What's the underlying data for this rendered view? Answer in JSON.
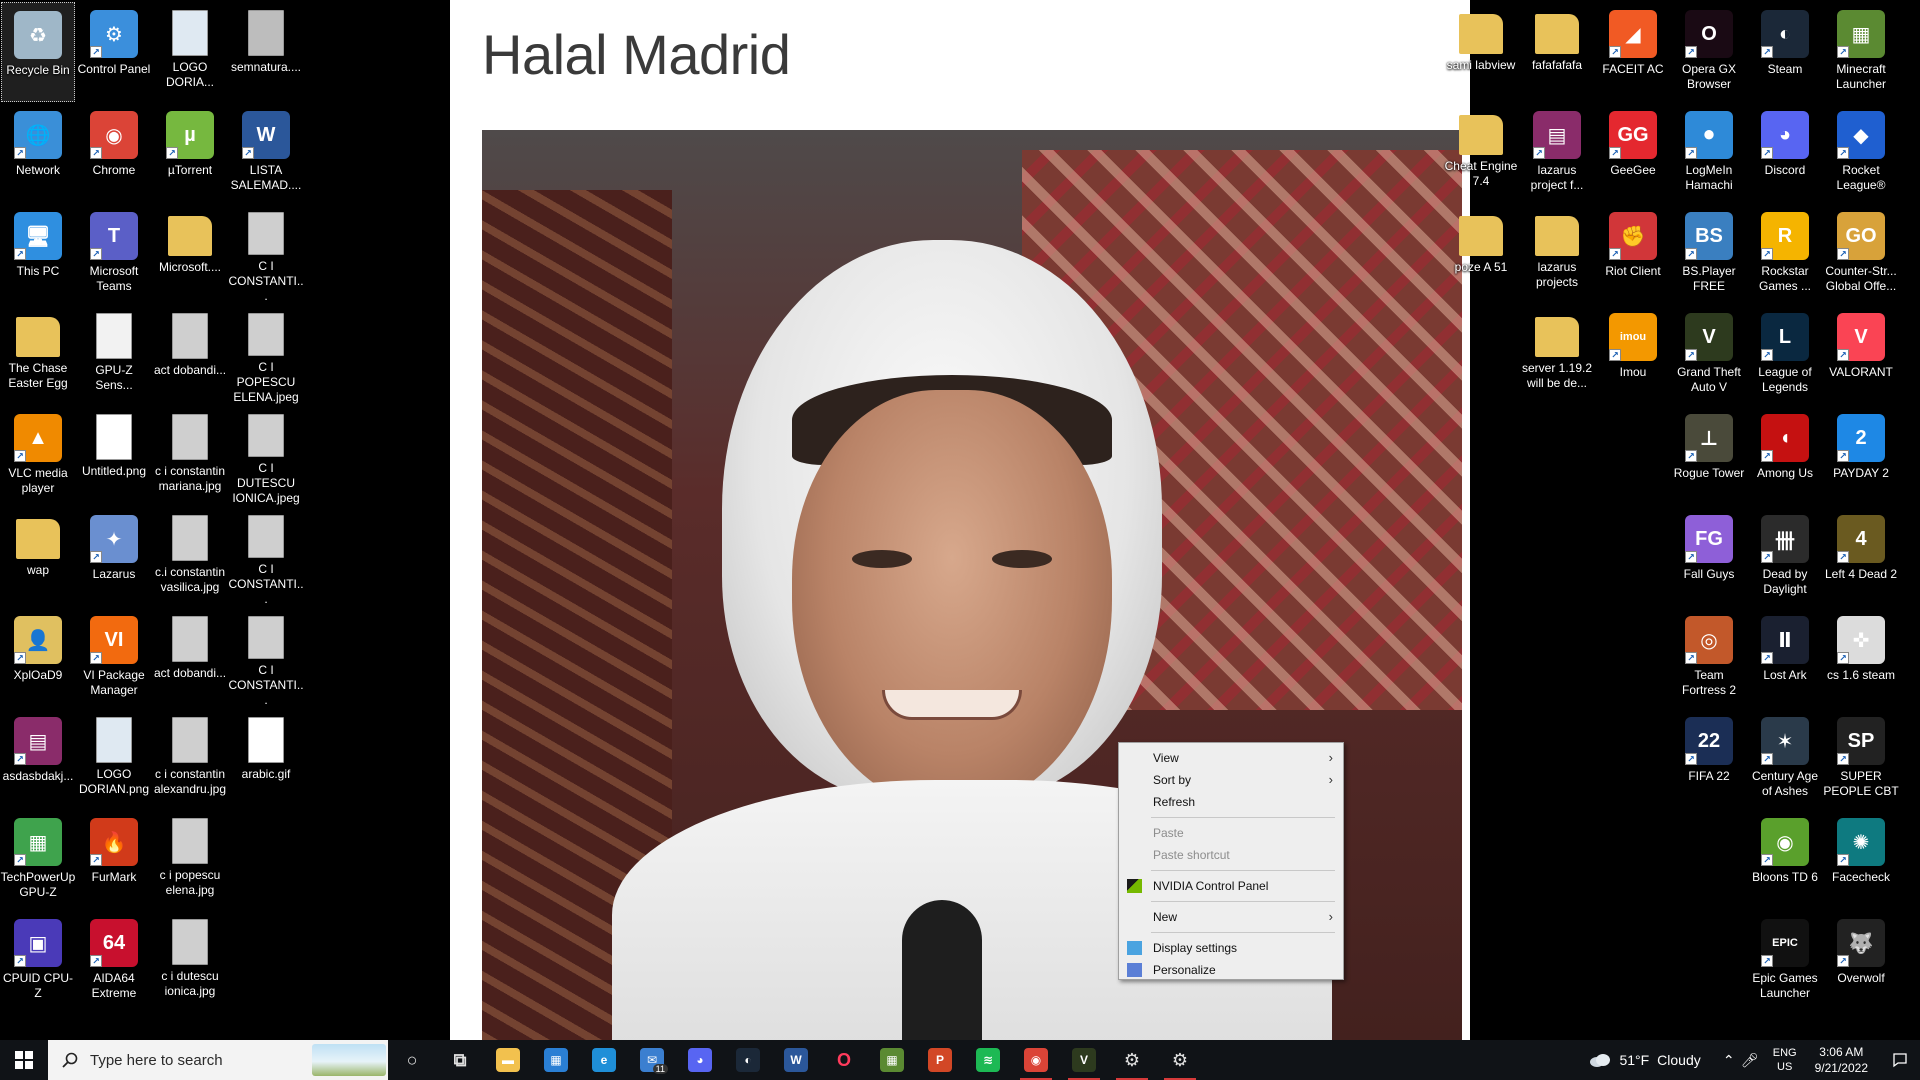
{
  "wallpaper": {
    "title": "Halal Madrid"
  },
  "left_icons": [
    [
      {
        "label": "Recycle Bin",
        "icon": "recycle-bin-icon",
        "color": "#9fb7c8",
        "glyph": "♻",
        "selected": true
      },
      {
        "label": "Network",
        "icon": "network-icon",
        "color": "#3a8fd8",
        "glyph": "🌐"
      },
      {
        "label": "This PC",
        "icon": "computer-icon",
        "color": "#2f8fe0",
        "glyph": "🖥"
      },
      {
        "label": "The Chase Easter Egg",
        "icon": "folder-icon",
        "color": "#e8c25a",
        "glyph": ""
      },
      {
        "label": "VLC media player",
        "icon": "vlc-icon",
        "color": "#f08a00",
        "glyph": "▲"
      },
      {
        "label": "wap",
        "icon": "folder-icon",
        "color": "#e8c25a",
        "glyph": ""
      },
      {
        "label": "XplOaD9",
        "icon": "user-folder-icon",
        "color": "#e0c060",
        "glyph": "👤"
      },
      {
        "label": "asdasbdakj...",
        "icon": "winrar-icon",
        "color": "#8a2c6a",
        "glyph": "▤"
      },
      {
        "label": "TechPowerUp GPU-Z",
        "icon": "gpuz-icon",
        "color": "#3fa34d",
        "glyph": "▦"
      },
      {
        "label": "CPUID CPU-Z",
        "icon": "cpuz-icon",
        "color": "#4a3ab8",
        "glyph": "▣"
      }
    ],
    [
      {
        "label": "Control Panel",
        "icon": "control-panel-icon",
        "color": "#3b8fdc",
        "glyph": "⚙"
      },
      {
        "label": "Chrome",
        "icon": "chrome-icon",
        "color": "#db4437",
        "glyph": "◉"
      },
      {
        "label": "Microsoft Teams",
        "icon": "teams-icon",
        "color": "#5b5fc7",
        "glyph": "T"
      },
      {
        "label": "GPU-Z Sens...",
        "icon": "text-file-icon",
        "color": "#f2f2f2",
        "glyph": ""
      },
      {
        "label": "Untitled.png",
        "icon": "image-file-icon",
        "color": "#ffffff",
        "glyph": ""
      },
      {
        "label": "Lazarus",
        "icon": "lazarus-icon",
        "color": "#6a8fd0",
        "glyph": "✦"
      },
      {
        "label": "VI Package Manager",
        "icon": "vipm-icon",
        "color": "#f26a0f",
        "glyph": "VI"
      },
      {
        "label": "LOGO DORIAN.png",
        "icon": "image-file-icon",
        "color": "#dfe9f2",
        "glyph": ""
      },
      {
        "label": "FurMark",
        "icon": "furmark-icon",
        "color": "#d13a1a",
        "glyph": "🔥"
      },
      {
        "label": "AIDA64 Extreme",
        "icon": "aida64-icon",
        "color": "#c8102e",
        "glyph": "64"
      }
    ],
    [
      {
        "label": "LOGO DORIA...",
        "icon": "image-file-icon",
        "color": "#dfe9f2",
        "glyph": ""
      },
      {
        "label": "µTorrent",
        "icon": "utorrent-icon",
        "color": "#76b83f",
        "glyph": "µ"
      },
      {
        "label": "Microsoft....",
        "icon": "folder-icon",
        "color": "#e8c25a",
        "glyph": ""
      },
      {
        "label": "act dobandi...",
        "icon": "image-file-icon",
        "color": "#cfcfcf",
        "glyph": ""
      },
      {
        "label": "c i constantin mariana.jpg",
        "icon": "image-file-icon",
        "color": "#cfcfcf",
        "glyph": ""
      },
      {
        "label": "c.i constantin vasilica.jpg",
        "icon": "image-file-icon",
        "color": "#cfcfcf",
        "glyph": ""
      },
      {
        "label": "act dobandi...",
        "icon": "image-file-icon",
        "color": "#cfcfcf",
        "glyph": ""
      },
      {
        "label": "c i constantin alexandru.jpg",
        "icon": "image-file-icon",
        "color": "#cfcfcf",
        "glyph": ""
      },
      {
        "label": "c i popescu elena.jpg",
        "icon": "image-file-icon",
        "color": "#cfcfcf",
        "glyph": ""
      },
      {
        "label": "c i dutescu ionica.jpg",
        "icon": "image-file-icon",
        "color": "#cfcfcf",
        "glyph": ""
      }
    ],
    [
      {
        "label": "semnatura....",
        "icon": "image-file-icon",
        "color": "#bdbdbd",
        "glyph": ""
      },
      {
        "label": "LISTA SALEMAD....",
        "icon": "word-doc-icon",
        "color": "#2b579a",
        "glyph": "W"
      },
      {
        "label": "C I CONSTANTI...",
        "icon": "image-file-icon",
        "color": "#cfcfcf",
        "glyph": ""
      },
      {
        "label": "C I POPESCU ELENA.jpeg",
        "icon": "image-file-icon",
        "color": "#cfcfcf",
        "glyph": ""
      },
      {
        "label": "C I DUTESCU IONICA.jpeg",
        "icon": "image-file-icon",
        "color": "#cfcfcf",
        "glyph": ""
      },
      {
        "label": "C I CONSTANTI...",
        "icon": "image-file-icon",
        "color": "#cfcfcf",
        "glyph": ""
      },
      {
        "label": "C I CONSTANTI...",
        "icon": "image-file-icon",
        "color": "#cfcfcf",
        "glyph": ""
      },
      {
        "label": "arabic.gif",
        "icon": "image-file-icon",
        "color": "#ffffff",
        "glyph": ""
      }
    ]
  ],
  "right_icons": [
    [
      {
        "label": "sami labview",
        "icon": "folder-icon",
        "color": "#e8c25a",
        "glyph": ""
      },
      {
        "label": "Cheat Engine 7.4",
        "icon": "folder-icon",
        "color": "#e8c25a",
        "glyph": ""
      },
      {
        "label": "poze A 51",
        "icon": "folder-icon",
        "color": "#e8c25a",
        "glyph": ""
      }
    ],
    [
      {
        "label": "fafafafafa",
        "icon": "folder-icon",
        "color": "#e8c25a",
        "glyph": ""
      },
      {
        "label": "lazarus project f...",
        "icon": "winrar-icon",
        "color": "#8a2c6a",
        "glyph": "▤"
      },
      {
        "label": "lazarus projects",
        "icon": "folder-icon",
        "color": "#e8c25a",
        "glyph": ""
      },
      {
        "label": "server 1.19.2 will be de...",
        "icon": "folder-icon",
        "color": "#e8c25a",
        "glyph": ""
      }
    ],
    [
      {
        "label": "FACEIT AC",
        "icon": "faceit-icon",
        "color": "#f15a24",
        "glyph": "◢"
      },
      {
        "label": "GeeGee",
        "icon": "geegee-icon",
        "color": "#e4282f",
        "glyph": "GG"
      },
      {
        "label": "Riot Client",
        "icon": "riot-icon",
        "color": "#d13639",
        "glyph": "✊"
      },
      {
        "label": "Imou",
        "icon": "imou-icon",
        "color": "#f39800",
        "glyph": "imou"
      }
    ],
    [
      {
        "label": "Opera GX Browser",
        "icon": "opera-gx-icon",
        "color": "#1a0a14",
        "glyph": "O"
      },
      {
        "label": "LogMeIn Hamachi",
        "icon": "hamachi-icon",
        "color": "#2e8ad8",
        "glyph": "⚫"
      },
      {
        "label": "BS.Player FREE",
        "icon": "bsplayer-icon",
        "color": "#3a7fc0",
        "glyph": "BS"
      },
      {
        "label": "Grand Theft Auto V",
        "icon": "gta-icon",
        "color": "#2d3a1e",
        "glyph": "V"
      },
      {
        "label": "Rogue Tower",
        "icon": "rogue-tower-icon",
        "color": "#4a4a3a",
        "glyph": "⊥"
      },
      {
        "label": "Fall Guys",
        "icon": "fall-guys-icon",
        "color": "#8e5fd8",
        "glyph": "FG"
      },
      {
        "label": "Team Fortress 2",
        "icon": "tf2-icon",
        "color": "#c2582a",
        "glyph": "◎"
      },
      {
        "label": "FIFA 22",
        "icon": "fifa-icon",
        "color": "#1b2e55",
        "glyph": "22"
      }
    ],
    [
      {
        "label": "Steam",
        "icon": "steam-icon",
        "color": "#1b2838",
        "glyph": "◐"
      },
      {
        "label": "Discord",
        "icon": "discord-icon",
        "color": "#5865f2",
        "glyph": "◕"
      },
      {
        "label": "Rockstar Games ...",
        "icon": "rockstar-icon",
        "color": "#f5b400",
        "glyph": "R"
      },
      {
        "label": "League of Legends",
        "icon": "lol-icon",
        "color": "#0a2840",
        "glyph": "L"
      },
      {
        "label": "Among Us",
        "icon": "among-us-icon",
        "color": "#c51111",
        "glyph": "◖"
      },
      {
        "label": "Dead by Daylight",
        "icon": "dbd-icon",
        "color": "#2b2b2b",
        "glyph": "卌"
      },
      {
        "label": "Lost Ark",
        "icon": "lost-ark-icon",
        "color": "#1a2030",
        "glyph": "Ⅱ"
      },
      {
        "label": "Century Age of Ashes",
        "icon": "century-icon",
        "color": "#2a3a4a",
        "glyph": "✶"
      },
      {
        "label": "Bloons TD 6",
        "icon": "bloons-icon",
        "color": "#5aa02c",
        "glyph": "◉"
      },
      {
        "label": "Epic Games Launcher",
        "icon": "epic-icon",
        "color": "#111111",
        "glyph": "EPIC"
      }
    ],
    [
      {
        "label": "Minecraft Launcher",
        "icon": "minecraft-icon",
        "color": "#5b8a32",
        "glyph": "▦"
      },
      {
        "label": "Rocket League®",
        "icon": "rocket-league-icon",
        "color": "#1f5fd0",
        "glyph": "◆"
      },
      {
        "label": "Counter-Str... Global Offe...",
        "icon": "csgo-icon",
        "color": "#d8a23a",
        "glyph": "GO"
      },
      {
        "label": "VALORANT",
        "icon": "valorant-icon",
        "color": "#fa4454",
        "glyph": "V"
      },
      {
        "label": "PAYDAY 2",
        "icon": "payday-icon",
        "color": "#1e88e5",
        "glyph": "2"
      },
      {
        "label": "Left 4 Dead 2",
        "icon": "l4d2-icon",
        "color": "#6a5a20",
        "glyph": "4"
      },
      {
        "label": "cs 1.6 steam",
        "icon": "cs16-icon",
        "color": "#dcdcdc",
        "glyph": "✜"
      },
      {
        "label": "SUPER PEOPLE CBT",
        "icon": "super-people-icon",
        "color": "#222222",
        "glyph": "SP"
      },
      {
        "label": "Facecheck",
        "icon": "facecheck-icon",
        "color": "#0e7a80",
        "glyph": "✺"
      },
      {
        "label": "Overwolf",
        "icon": "overwolf-icon",
        "color": "#222222",
        "glyph": "🐺"
      }
    ]
  ],
  "context_menu": {
    "items": [
      {
        "label": "View",
        "submenu": true,
        "disabled": false
      },
      {
        "label": "Sort by",
        "submenu": true,
        "disabled": false
      },
      {
        "label": "Refresh",
        "submenu": false,
        "disabled": false
      },
      {
        "sep": true
      },
      {
        "label": "Paste",
        "submenu": false,
        "disabled": true
      },
      {
        "label": "Paste shortcut",
        "submenu": false,
        "disabled": true
      },
      {
        "sep": true
      },
      {
        "label": "NVIDIA Control Panel",
        "submenu": false,
        "disabled": false,
        "icon": "nvidia-icon"
      },
      {
        "sep": true
      },
      {
        "label": "New",
        "submenu": true,
        "disabled": false
      },
      {
        "sep": true
      },
      {
        "label": "Display settings",
        "submenu": false,
        "disabled": false,
        "icon": "display-icon"
      },
      {
        "label": "Personalize",
        "submenu": false,
        "disabled": false,
        "icon": "personalize-icon"
      }
    ]
  },
  "taskbar": {
    "search_placeholder": "Type here to search",
    "apps": [
      {
        "name": "cortana-icon",
        "color": "transparent",
        "glyph": "○",
        "active": false
      },
      {
        "name": "task-view-icon",
        "color": "transparent",
        "glyph": "⧉",
        "active": false
      },
      {
        "name": "file-explorer-icon",
        "color": "#f2c14e",
        "glyph": "▬",
        "active": false
      },
      {
        "name": "microsoft-store-icon",
        "color": "#2a7fd4",
        "glyph": "▦",
        "active": false
      },
      {
        "name": "edge-icon",
        "color": "#1f8fd8",
        "glyph": "e",
        "active": false
      },
      {
        "name": "mail-icon",
        "color": "#3b7fd0",
        "glyph": "✉",
        "active": false,
        "badge": "11"
      },
      {
        "name": "discord-icon",
        "color": "#5865f2",
        "glyph": "◕",
        "active": false
      },
      {
        "name": "steam-icon",
        "color": "#1b2838",
        "glyph": "◐",
        "active": false
      },
      {
        "name": "word-icon",
        "color": "#2b579a",
        "glyph": "W",
        "active": false
      },
      {
        "name": "opera-gx-icon",
        "color": "transparent",
        "glyph": "O",
        "active": false
      },
      {
        "name": "minecraft-icon",
        "color": "#5b8a32",
        "glyph": "▦",
        "active": false
      },
      {
        "name": "powerpoint-icon",
        "color": "#d24726",
        "glyph": "P",
        "active": false
      },
      {
        "name": "spotify-icon",
        "color": "#1db954",
        "glyph": "≋",
        "active": false
      },
      {
        "name": "chrome-icon",
        "color": "#db4437",
        "glyph": "◉",
        "active": true
      },
      {
        "name": "gta-icon",
        "color": "#2d3a1e",
        "glyph": "V",
        "active": true
      },
      {
        "name": "cheat-engine-icon",
        "color": "transparent",
        "glyph": "⚙",
        "active": true
      },
      {
        "name": "settings-icon",
        "color": "transparent",
        "glyph": "⚙",
        "active": true
      }
    ],
    "weather": {
      "temp": "51°F",
      "condition": "Cloudy"
    },
    "language": {
      "line1": "ENG",
      "line2": "US"
    },
    "clock": {
      "time": "3:06 AM",
      "date": "9/21/2022"
    }
  }
}
